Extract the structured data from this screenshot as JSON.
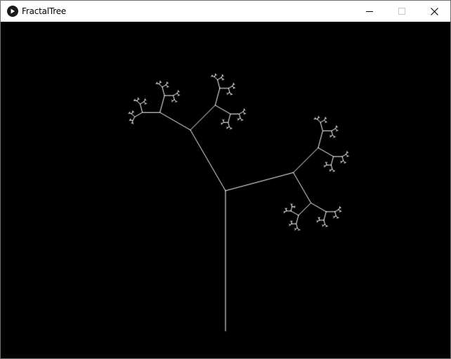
{
  "window": {
    "title": "FractalTree",
    "app_icon": "play-icon",
    "controls": {
      "minimize_icon": "minimize-icon",
      "maximize_icon": "maximize-icon",
      "close_icon": "close-icon"
    }
  },
  "canvas": {
    "background": "#000000",
    "stroke": "#ffffff",
    "trunk_length": 200,
    "branch_angle_left_deg": 30,
    "branch_angle_right_deg": 75,
    "length_ratio": 0.5,
    "min_length": 1
  }
}
